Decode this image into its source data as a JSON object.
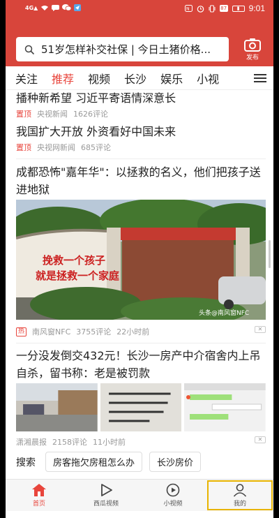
{
  "status": {
    "left_icons": [
      "signal-icon",
      "wifi-icon",
      "message-icon",
      "wechat-icon",
      "send-icon"
    ],
    "battery": "87",
    "time": "9:01"
  },
  "header": {
    "search_text": "51岁怎样补交社保 | 今日土猪价格...",
    "publish_label": "发布",
    "accent": "#d8453b"
  },
  "tabs": [
    "关注",
    "推荐",
    "视频",
    "长沙",
    "娱乐",
    "小视"
  ],
  "active_tab": "推荐",
  "feed": {
    "top_title_partial": "播种新希望 习近平寄语情深意长",
    "item1": {
      "pin": "置顶",
      "source": "央视新闻",
      "comments": "1626评论"
    },
    "item2": {
      "title": "我国扩大开放 外资看好中国未来",
      "pin": "置顶",
      "source": "央视网新闻",
      "comments": "685评论"
    },
    "item3": {
      "title": "成都恐怖\"嘉年华\"：以拯救的名义，他们把孩子送进地狱",
      "image_sign_1": "挽救一个孩子",
      "image_sign_2": "就是拯救一个家庭",
      "watermark": "头条@南风窗NFC",
      "hot": "热",
      "source": "南风窗NFC",
      "comments": "3755评论",
      "time": "22小时前"
    },
    "item4": {
      "title": "一分没发倒交432元！长沙一房产中介宿舍内上吊自杀，留书称：老是被罚款",
      "source": "潇湘晨报",
      "comments": "2158评论",
      "time": "11小时前"
    },
    "search_label": "搜索",
    "suggestions": [
      "房客拖欠房租怎么办",
      "长沙房价"
    ]
  },
  "bottom_nav": [
    {
      "label": "首页",
      "icon": "home-icon"
    },
    {
      "label": "西瓜视频",
      "icon": "play-icon"
    },
    {
      "label": "小视频",
      "icon": "video-icon"
    },
    {
      "label": "我的",
      "icon": "user-icon"
    }
  ]
}
